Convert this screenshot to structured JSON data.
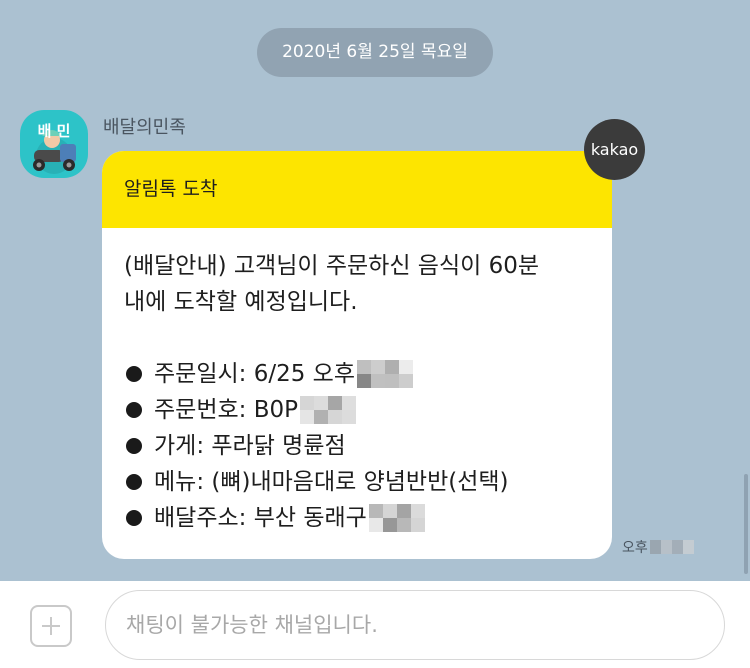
{
  "date_divider": "2020년 6월 25일 목요일",
  "sender": {
    "name": "배달의민족",
    "avatar_text": "배  민",
    "avatar_color": "#2dc3c8"
  },
  "message": {
    "header_title": "알림톡 도착",
    "header_color": "#fde500",
    "intro_line1": "(배달안내) 고객님이 주문하신 음식이 60분",
    "intro_line2": "내에 도착할 예정입니다.",
    "details": [
      {
        "label": "주문일시: 6/25 오후",
        "masked": true
      },
      {
        "label": "주문번호: B0P",
        "masked": true
      },
      {
        "label": "가게: 푸라닭 명륜점",
        "masked": false
      },
      {
        "label": "메뉴: (뼈)내마음대로 양념반반(선택)",
        "masked": false
      },
      {
        "label": "배달주소: 부산 동래구",
        "masked": true
      }
    ]
  },
  "badge": {
    "label": "kakao"
  },
  "timestamp": {
    "prefix": "오후"
  },
  "composer": {
    "placeholder": "채팅이 불가능한 채널입니다."
  },
  "colors": {
    "chat_background": "#abc1d1",
    "date_pill": "#91a3b2",
    "badge": "#3b3b3b"
  }
}
